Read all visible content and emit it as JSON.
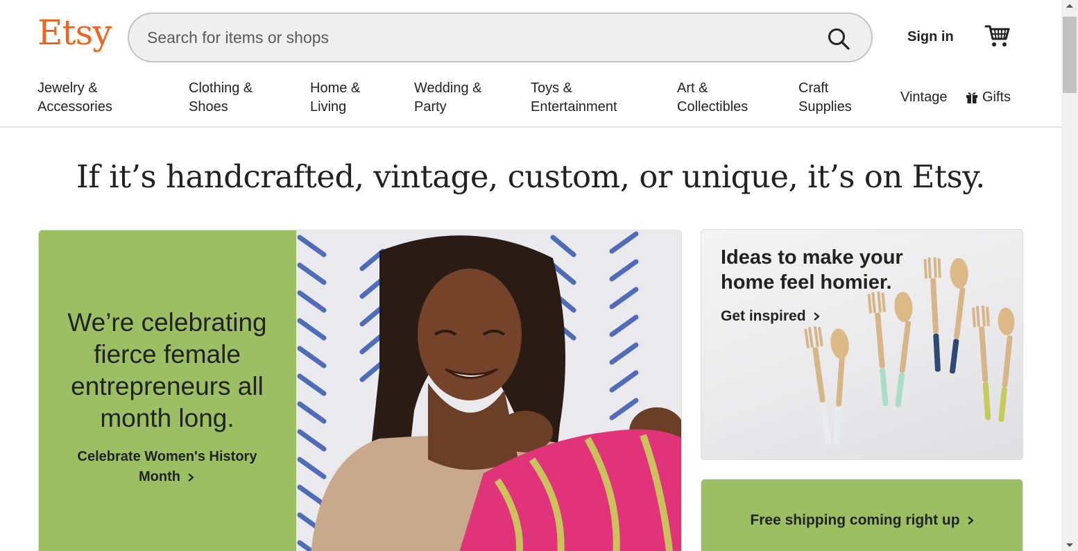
{
  "brand": {
    "logo_text": "Etsy",
    "accent_color": "#F1641E"
  },
  "header": {
    "search_placeholder": "Search for items or shops",
    "search_icon": "search-icon",
    "sign_in_label": "Sign in",
    "cart_icon": "cart-icon"
  },
  "nav": {
    "items": [
      {
        "label": "Jewelry &\nAccessories"
      },
      {
        "label": "Clothing &\nShoes"
      },
      {
        "label": "Home &\nLiving"
      },
      {
        "label": "Wedding &\nParty"
      },
      {
        "label": "Toys &\nEntertainment"
      },
      {
        "label": "Art &\nCollectibles"
      },
      {
        "label": "Craft\nSupplies"
      },
      {
        "label": "Vintage"
      }
    ],
    "gifts_label": "Gifts",
    "gifts_icon": "gift-icon"
  },
  "hero": {
    "headline": "If it’s handcrafted, vintage, custom, or unique, it’s on Etsy.",
    "promo": {
      "title": "We’re celebrating fierce female entrepreneurs all month long.",
      "link_label": "Celebrate Women's History Month",
      "background_color": "#9dbf64"
    },
    "ideas": {
      "title": "Ideas to make your home feel homier.",
      "link_label": "Get inspired"
    },
    "shipping": {
      "label": "Free shipping coming right up"
    }
  }
}
